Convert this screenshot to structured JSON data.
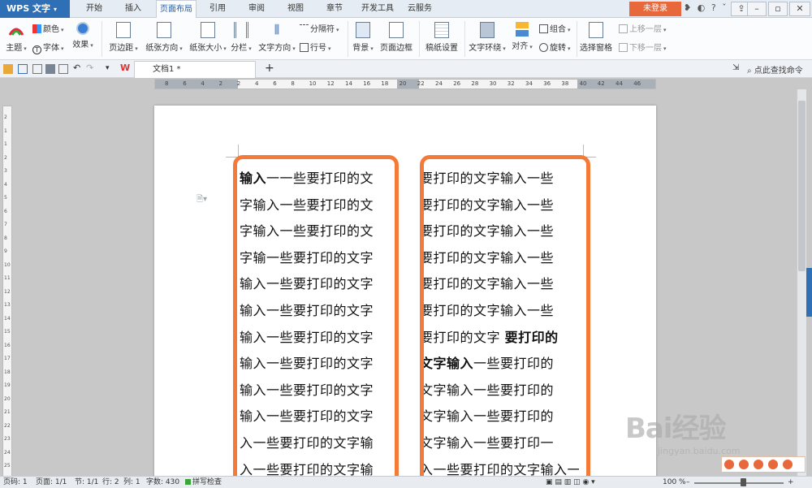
{
  "app": {
    "logo": "WPS 文字",
    "login": "未登录"
  },
  "menu": {
    "tabs": [
      {
        "label": "开始",
        "active": false
      },
      {
        "label": "插入",
        "active": false
      },
      {
        "label": "页面布局",
        "active": true
      },
      {
        "label": "引用",
        "active": false
      },
      {
        "label": "审阅",
        "active": false
      },
      {
        "label": "视图",
        "active": false
      },
      {
        "label": "章节",
        "active": false
      },
      {
        "label": "开发工具",
        "active": false
      },
      {
        "label": "云服务",
        "active": false
      }
    ]
  },
  "ribbon": {
    "color": "颜色",
    "theme": "主题",
    "font": "字体",
    "effect": "效果",
    "margins": "页边距",
    "orientation": "纸张方向",
    "size": "纸张大小",
    "columns": "分栏",
    "text_direction": "文字方向",
    "separator": "分隔符",
    "line_numbers": "行号",
    "background": "背景",
    "page_border": "页面边框",
    "manuscript": "稿纸设置",
    "text_wrap": "文字环绕",
    "align": "对齐",
    "group": "组合",
    "rotate": "旋转",
    "selection_pane": "选择窗格",
    "bring_forward": "上移一层",
    "send_backward": "下移一层"
  },
  "quickbar": {
    "doc_tab": "文档1 *",
    "search": "点此查找命令"
  },
  "document": {
    "left_column": [
      [
        "输入",
        "一一些要打印的文"
      ],
      [
        "",
        "字输入一些要打印的文"
      ],
      [
        "",
        "字输入一些要打印的文"
      ],
      [
        "",
        "字输一些要打印的文字"
      ],
      [
        "",
        "输入一些要打印的文字"
      ],
      [
        "",
        "输入一些要打印的文字"
      ],
      [
        "",
        "输入一些要打印的文字"
      ],
      [
        "",
        "输入一些要打印的文字"
      ],
      [
        "",
        "输入一些要打印的文字"
      ],
      [
        "",
        "输入一些要打印的文字"
      ],
      [
        "",
        "入一些要打印的文字输"
      ],
      [
        "",
        "入一些要打印的文字输"
      ]
    ],
    "right_column": [
      [
        "",
        "要打印的文字输入一些",
        ""
      ],
      [
        "",
        "要打印的文字输入一些",
        ""
      ],
      [
        "",
        "要打印的文字输入一些",
        ""
      ],
      [
        "",
        "要打印的文字输入一些",
        ""
      ],
      [
        "",
        "要打印的文字输入一些",
        ""
      ],
      [
        "",
        "要打印的文字输入一些",
        ""
      ],
      [
        "",
        "要打印的文字 ",
        "要打印的"
      ],
      [
        "文字输入",
        "一些要打印的",
        ""
      ],
      [
        "",
        "文字输入一些要打印的",
        ""
      ],
      [
        "",
        "文字输入一些要打印的",
        ""
      ],
      [
        "",
        "文字输入一些要打印一",
        ""
      ],
      [
        "",
        "入一些要打印的文字输入一",
        ""
      ]
    ],
    "highlight_color": "#f47a3a"
  },
  "ruler": {
    "h_labels": [
      "8",
      "6",
      "4",
      "2",
      "2",
      "4",
      "6",
      "8",
      "10",
      "12",
      "14",
      "16",
      "18",
      "20",
      "22",
      "24",
      "26",
      "28",
      "30",
      "32",
      "34",
      "36",
      "38",
      "40",
      "42",
      "44",
      "46"
    ],
    "v_labels": [
      "2",
      "1",
      "1",
      "2",
      "3",
      "4",
      "5",
      "6",
      "7",
      "8",
      "9",
      "10",
      "11",
      "12",
      "13",
      "14",
      "15",
      "16",
      "17",
      "18",
      "19",
      "20",
      "21",
      "22",
      "23",
      "24",
      "25"
    ]
  },
  "status": {
    "page": "页码: 1",
    "pages": "页面: 1/1",
    "section": "节: 1/1",
    "row": "行: 2",
    "col": "列: 1",
    "words": "字数: 430",
    "spell": "拼写检查",
    "zoom": "100 %"
  },
  "watermark": {
    "brand": "Bai经验",
    "url": "jingyan.baidu.com"
  }
}
